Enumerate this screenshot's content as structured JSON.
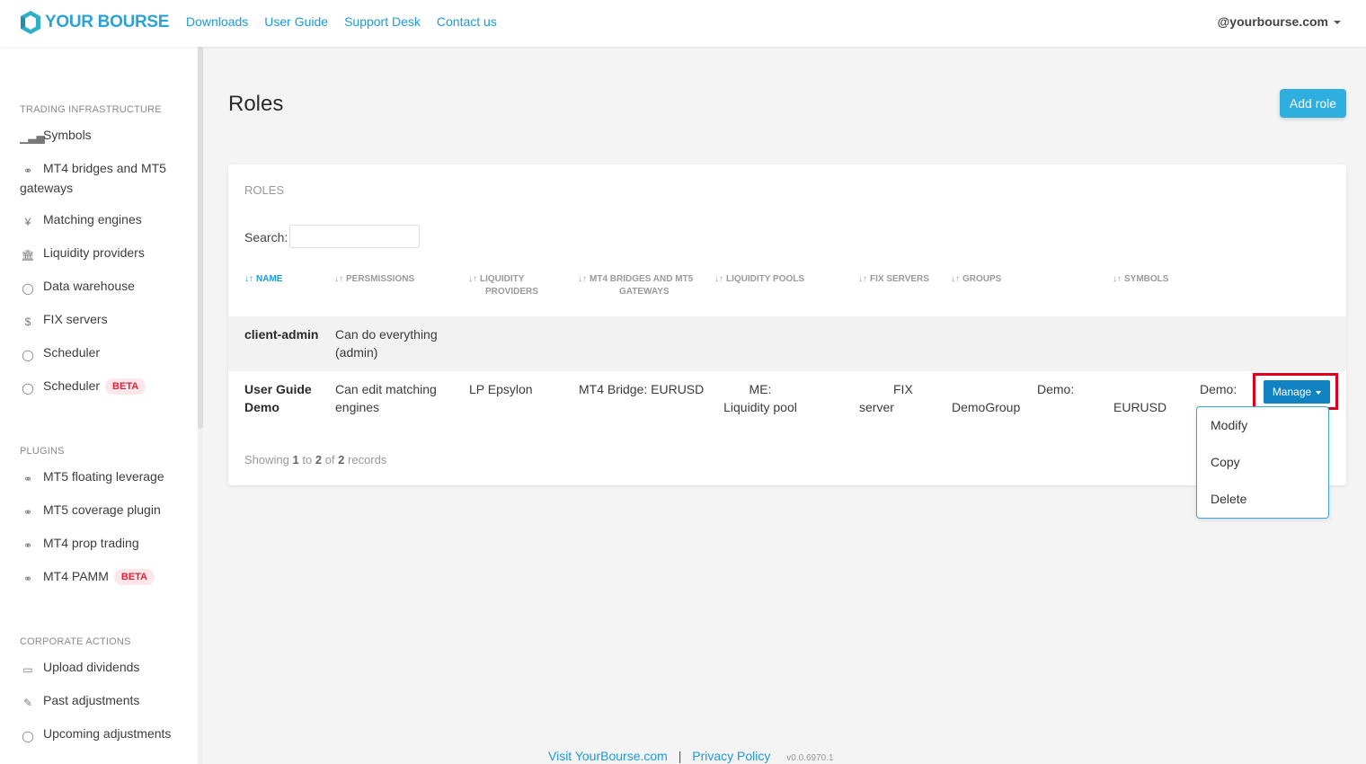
{
  "brand": {
    "name": "YOUR BOURSE",
    "accent": "#29a3d6"
  },
  "topnav": {
    "links": [
      "Downloads",
      "User Guide",
      "Support Desk",
      "Contact us"
    ],
    "user": "@yourbourse.com"
  },
  "sidebar": {
    "sections": [
      {
        "title": "TRADING INFRASTRUCTURE",
        "items": [
          {
            "label": "Symbols",
            "icon": "bar-chart-icon"
          },
          {
            "label": "MT4 bridges and MT5",
            "label2": "gateways",
            "icon": "bridge-icon"
          },
          {
            "label": "Matching engines",
            "icon": "currency-icon"
          },
          {
            "label": "Liquidity providers",
            "icon": "bank-icon"
          },
          {
            "label": "Data warehouse",
            "icon": "circle-icon"
          },
          {
            "label": "FIX servers",
            "icon": "dollar-doc-icon"
          },
          {
            "label": "Scheduler",
            "icon": "circle-icon"
          },
          {
            "label": "Scheduler",
            "icon": "circle-icon",
            "badge": "BETA"
          }
        ]
      },
      {
        "title": "PLUGINS",
        "items": [
          {
            "label": "MT5 floating leverage",
            "icon": "bridge-icon"
          },
          {
            "label": "MT5 coverage plugin",
            "icon": "bridge-icon"
          },
          {
            "label": "MT4 prop trading",
            "icon": "bridge-icon"
          },
          {
            "label": "MT4 PAMM",
            "icon": "bridge-icon",
            "badge": "BETA"
          }
        ]
      },
      {
        "title": "CORPORATE ACTIONS",
        "items": [
          {
            "label": "Upload dividends",
            "icon": "folder-icon"
          },
          {
            "label": "Past adjustments",
            "icon": "edit-icon"
          },
          {
            "label": "Upcoming adjustments",
            "icon": "circle-icon"
          }
        ]
      }
    ]
  },
  "page": {
    "title": "Roles",
    "add_button": "Add role"
  },
  "card": {
    "title": "ROLES",
    "search_label": "Search:",
    "columns": [
      [
        "NAME"
      ],
      [
        "PERSMISSIONS"
      ],
      [
        "LIQUIDITY",
        "PROVIDERS"
      ],
      [
        "MT4 BRIDGES AND MT5",
        "GATEWAYS"
      ],
      [
        "LIQUIDITY POOLS"
      ],
      [
        "FIX SERVERS"
      ],
      [
        "GROUPS"
      ],
      [
        "SYMBOLS"
      ]
    ],
    "rows": [
      {
        "name": [
          "client-admin"
        ],
        "permissions": [
          "Can do everything",
          "(admin)"
        ]
      },
      {
        "name": [
          "User Guide",
          "Demo"
        ],
        "permissions": [
          "Can edit matching",
          "engines"
        ],
        "liquidity_providers": "LP Epsylon",
        "bridges": "MT4 Bridge: EURUSD",
        "pools": [
          "ME:",
          "Liquidity pool"
        ],
        "fix": [
          "FIX",
          "server"
        ],
        "groups": [
          "Demo:",
          "DemoGroup"
        ],
        "symbols": [
          "Demo:",
          "EURUSD"
        ]
      }
    ],
    "showing": {
      "prefix": "Showing",
      "from": "1",
      "to_word": "to",
      "to": "2",
      "of_word": "of",
      "total": "2",
      "suffix": "records"
    }
  },
  "manage": {
    "label": "Manage",
    "menu": [
      "Modify",
      "Copy",
      "Delete"
    ]
  },
  "footer": {
    "link1": "Visit YourBourse.com",
    "sep": "|",
    "link2": "Privacy Policy",
    "version": "v0.0.6970.1"
  }
}
